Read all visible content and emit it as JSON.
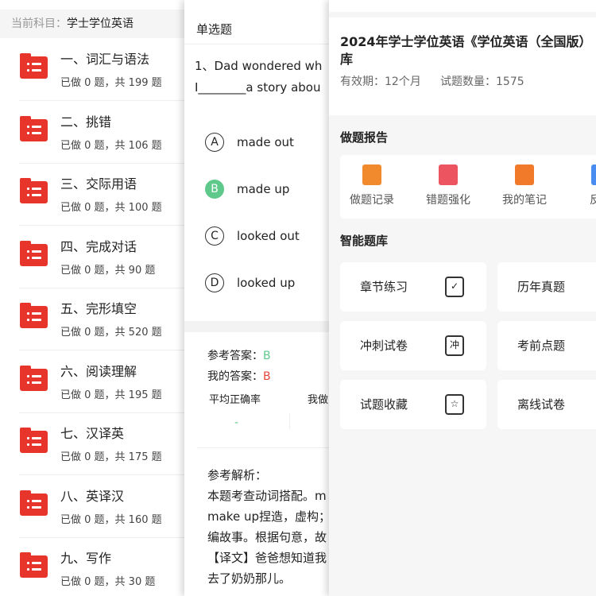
{
  "chapters": {
    "subject_label": "当前科目：",
    "subject": "学士学位英语",
    "items": [
      {
        "title": "一、词汇与语法",
        "stats": "已做 0 题，共 199 题"
      },
      {
        "title": "二、挑错",
        "stats": "已做 0 题，共 106 题"
      },
      {
        "title": "三、交际用语",
        "stats": "已做 0 题，共 100 题"
      },
      {
        "title": "四、完成对话",
        "stats": "已做 0 题，共 90 题"
      },
      {
        "title": "五、完形填空",
        "stats": "已做 0 题，共 520 题"
      },
      {
        "title": "六、阅读理解",
        "stats": "已做 0 题，共 195 题"
      },
      {
        "title": "七、汉译英",
        "stats": "已做 0 题，共 175 题"
      },
      {
        "title": "八、英译汉",
        "stats": "已做 0 题，共 160 题"
      },
      {
        "title": "九、写作",
        "stats": "已做 0 题，共 30 题"
      }
    ]
  },
  "question": {
    "type": "单选题",
    "lines": [
      "1、Dad wondered wh",
      "I________a story abou"
    ],
    "options": [
      {
        "key": "A",
        "text": "made out"
      },
      {
        "key": "B",
        "text": "made up"
      },
      {
        "key": "C",
        "text": "looked out"
      },
      {
        "key": "D",
        "text": "looked up"
      }
    ],
    "ref_label": "参考答案：",
    "ref": "B",
    "my_label": "我的答案：",
    "my": "B",
    "avg_label": "平均正确率",
    "my_stat_label": "我做",
    "avg_value": "-",
    "analysis_label": "参考解析：",
    "analysis": [
      "本题考查动词搭配。m",
      "make up捏造，虚构；",
      "编故事。根据句意，故",
      "【译文】爸爸想知道我",
      "去了奶奶那儿。"
    ]
  },
  "bank": {
    "title_lines": [
      "2024年学士学位英语《学位英语（全国版）",
      "库"
    ],
    "validity": "有效期：12个月",
    "count": "试题数量：1575",
    "report_header": "做题报告",
    "report": [
      {
        "label": "做题记录",
        "icon": "record-icon",
        "color": "#f08a2c"
      },
      {
        "label": "错题强化",
        "icon": "wrong-icon",
        "color": "#ec5460"
      },
      {
        "label": "我的笔记",
        "icon": "note-icon",
        "color": "#f07a2a"
      },
      {
        "label": "反馈",
        "icon": "feedback-icon",
        "color": "#4a8df0"
      }
    ],
    "smart_header": "智能题库",
    "tiles": [
      {
        "label": "章节练习",
        "icon": "chapter-icon",
        "glyph": "✓"
      },
      {
        "label": "历年真题"
      },
      {
        "label": "冲刺试卷",
        "icon": "sprint-icon",
        "glyph": "冲"
      },
      {
        "label": "考前点题"
      },
      {
        "label": "试题收藏",
        "icon": "favorite-icon",
        "glyph": "☆"
      },
      {
        "label": "离线试卷"
      }
    ]
  }
}
